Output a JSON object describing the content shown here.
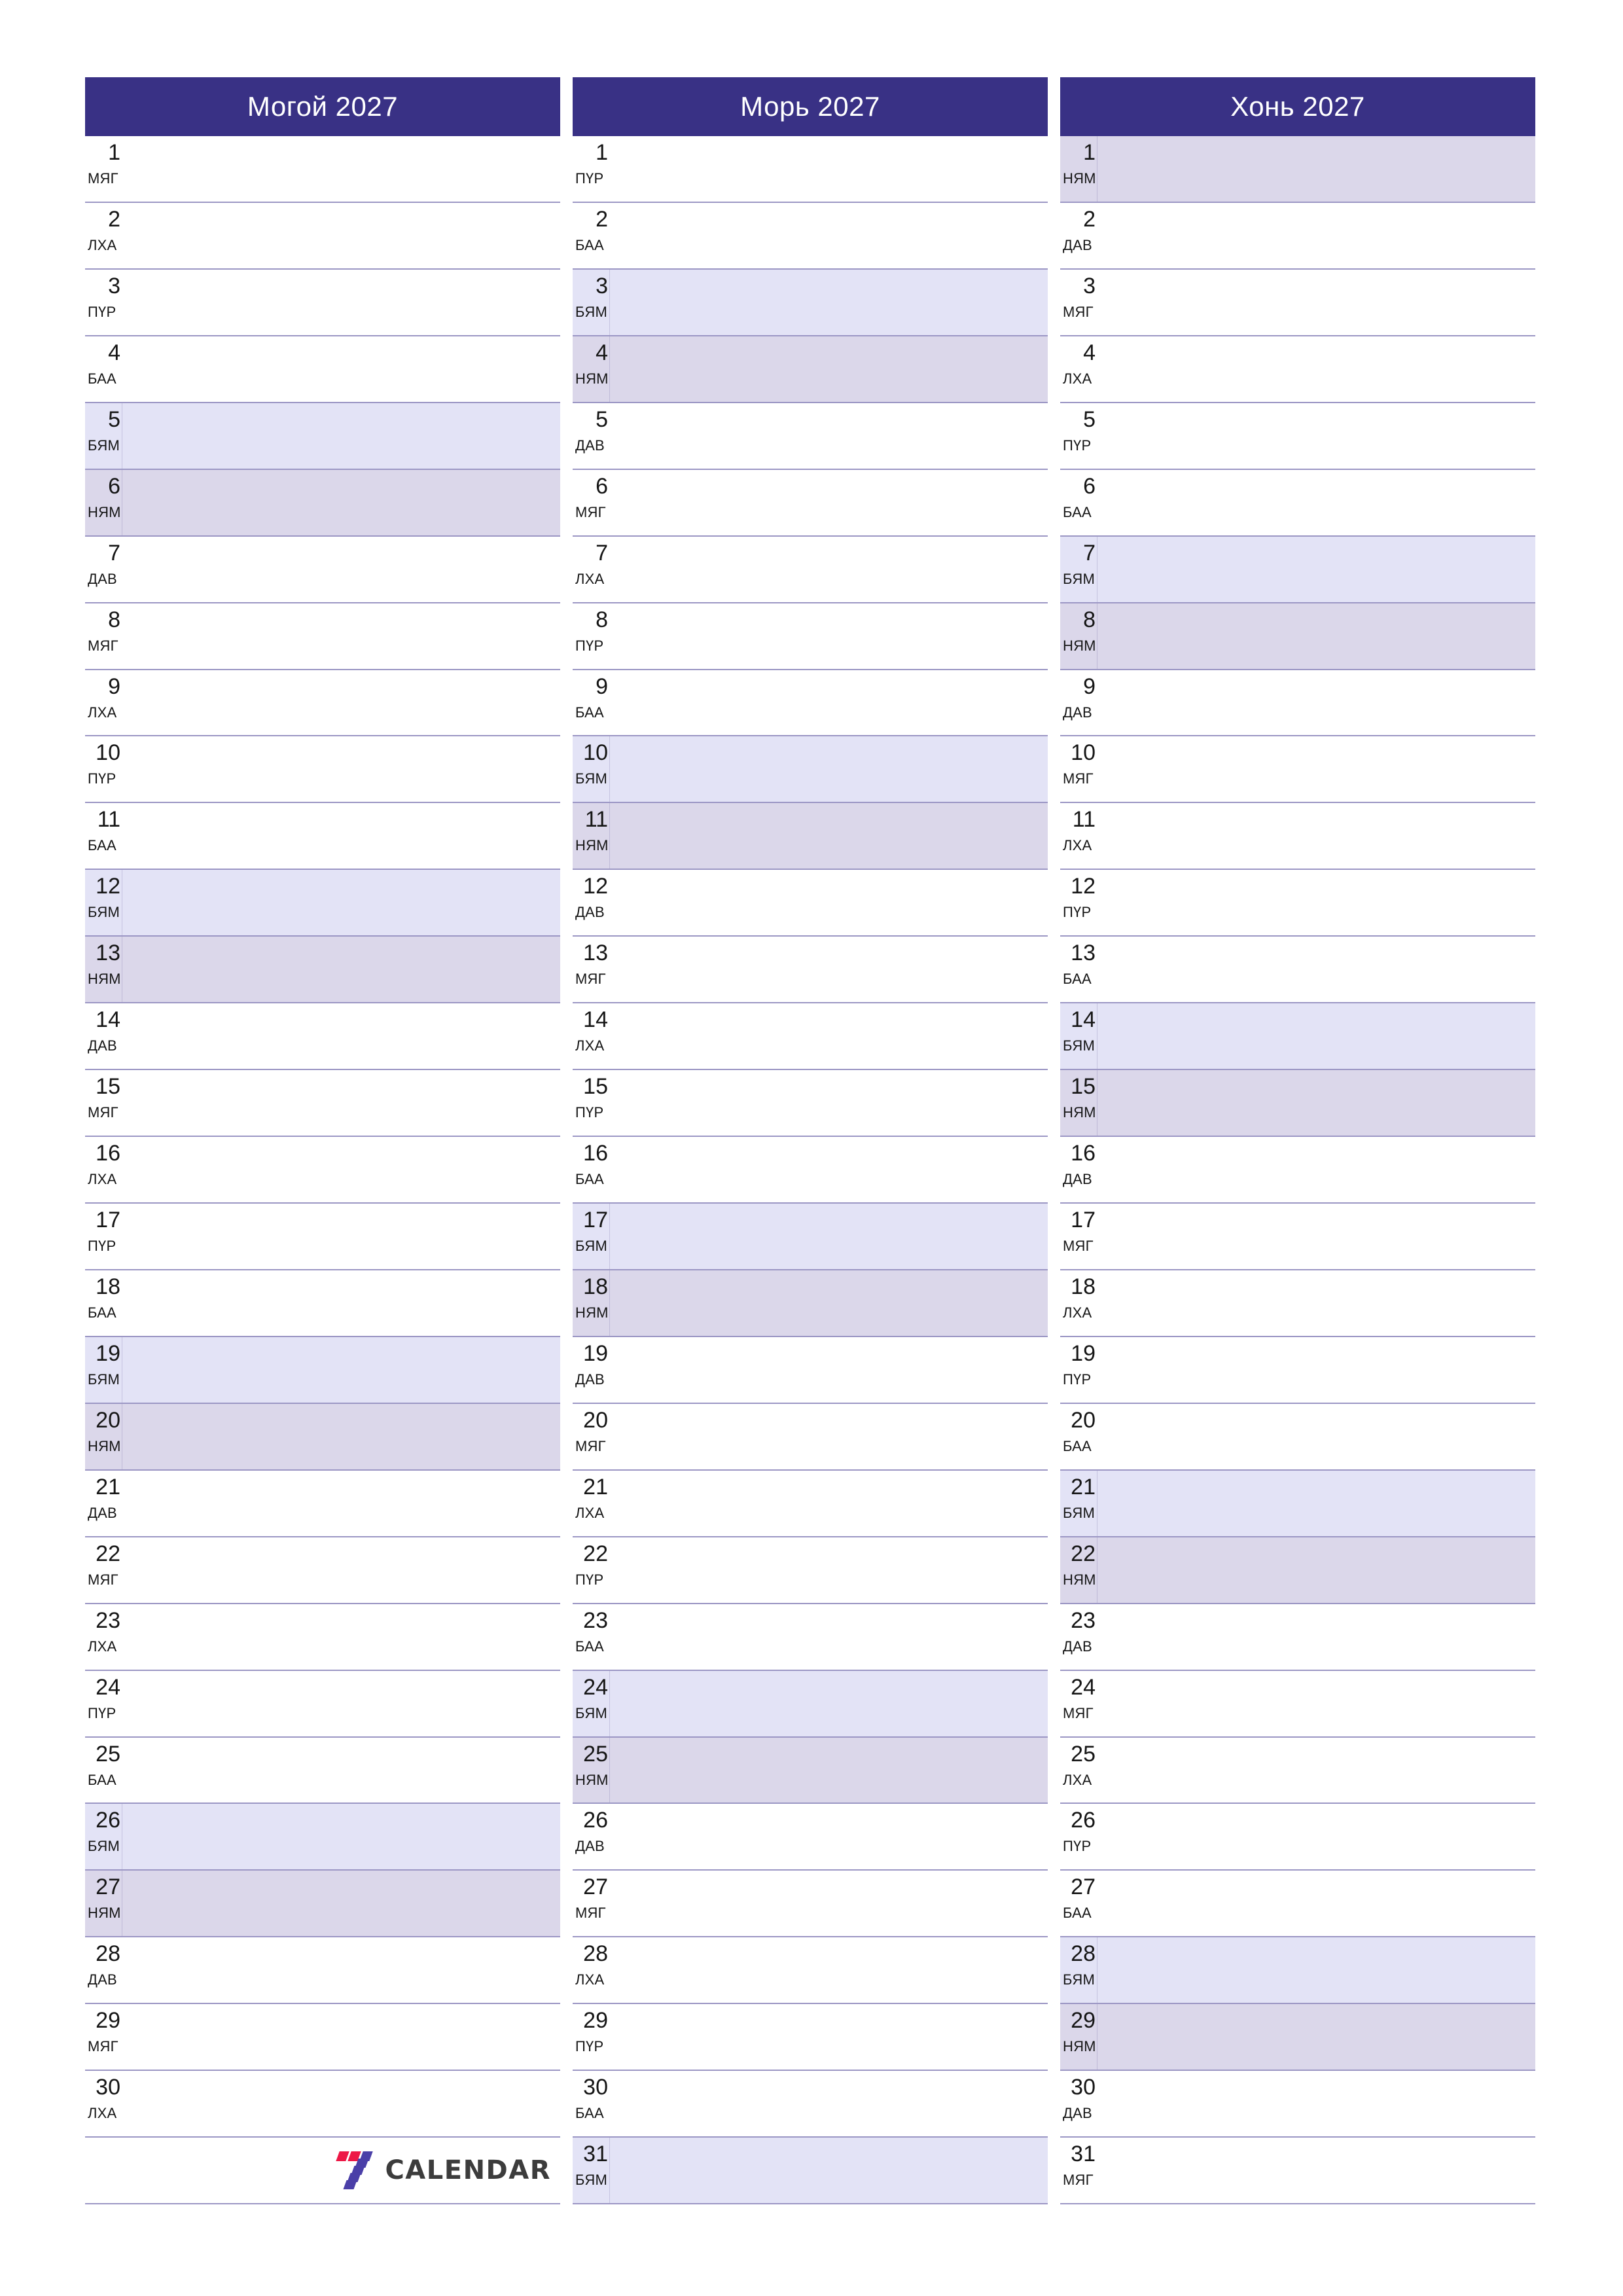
{
  "page": {
    "type": "monthly-planner",
    "year": "2027",
    "columns": 3,
    "orientation": "portrait"
  },
  "theme": {
    "header_bg": "#393185",
    "header_text": "#ffffff",
    "grid_line": "#9b96c4",
    "saturday_bg": "#e3e3f6",
    "sunday_bg": "#dbd7ea",
    "page_bg": "#ffffff",
    "day_text": "#161616"
  },
  "weekday_labels": {
    "mon": "ДАВ",
    "tue": "МЯГ",
    "wed": "ЛХА",
    "thu": "ПҮР",
    "fri": "БАА",
    "sat": "БЯМ",
    "sun": "НЯМ"
  },
  "footer": {
    "logo_text": "CALENDAR",
    "logo_mark": "seven-mark",
    "colors": {
      "red": "#ed1846",
      "purple": "#4a3fa8",
      "text": "#3c3c3c"
    }
  },
  "months": [
    {
      "title": "Могой 2027",
      "days": [
        {
          "num": "1",
          "name": "МЯГ",
          "kind": "plain"
        },
        {
          "num": "2",
          "name": "ЛХА",
          "kind": "plain"
        },
        {
          "num": "3",
          "name": "ПҮР",
          "kind": "plain"
        },
        {
          "num": "4",
          "name": "БАА",
          "kind": "plain"
        },
        {
          "num": "5",
          "name": "БЯМ",
          "kind": "sat"
        },
        {
          "num": "6",
          "name": "НЯМ",
          "kind": "sun"
        },
        {
          "num": "7",
          "name": "ДАВ",
          "kind": "plain"
        },
        {
          "num": "8",
          "name": "МЯГ",
          "kind": "plain"
        },
        {
          "num": "9",
          "name": "ЛХА",
          "kind": "plain"
        },
        {
          "num": "10",
          "name": "ПҮР",
          "kind": "plain"
        },
        {
          "num": "11",
          "name": "БАА",
          "kind": "plain"
        },
        {
          "num": "12",
          "name": "БЯМ",
          "kind": "sat"
        },
        {
          "num": "13",
          "name": "НЯМ",
          "kind": "sun"
        },
        {
          "num": "14",
          "name": "ДАВ",
          "kind": "plain"
        },
        {
          "num": "15",
          "name": "МЯГ",
          "kind": "plain"
        },
        {
          "num": "16",
          "name": "ЛХА",
          "kind": "plain"
        },
        {
          "num": "17",
          "name": "ПҮР",
          "kind": "plain"
        },
        {
          "num": "18",
          "name": "БАА",
          "kind": "plain"
        },
        {
          "num": "19",
          "name": "БЯМ",
          "kind": "sat"
        },
        {
          "num": "20",
          "name": "НЯМ",
          "kind": "sun"
        },
        {
          "num": "21",
          "name": "ДАВ",
          "kind": "plain"
        },
        {
          "num": "22",
          "name": "МЯГ",
          "kind": "plain"
        },
        {
          "num": "23",
          "name": "ЛХА",
          "kind": "plain"
        },
        {
          "num": "24",
          "name": "ПҮР",
          "kind": "plain"
        },
        {
          "num": "25",
          "name": "БАА",
          "kind": "plain"
        },
        {
          "num": "26",
          "name": "БЯМ",
          "kind": "sat"
        },
        {
          "num": "27",
          "name": "НЯМ",
          "kind": "sun"
        },
        {
          "num": "28",
          "name": "ДАВ",
          "kind": "plain"
        },
        {
          "num": "29",
          "name": "МЯГ",
          "kind": "plain"
        },
        {
          "num": "30",
          "name": "ЛХА",
          "kind": "plain"
        },
        {
          "num": "",
          "name": "",
          "kind": "empty"
        }
      ]
    },
    {
      "title": "Морь 2027",
      "days": [
        {
          "num": "1",
          "name": "ПҮР",
          "kind": "plain"
        },
        {
          "num": "2",
          "name": "БАА",
          "kind": "plain"
        },
        {
          "num": "3",
          "name": "БЯМ",
          "kind": "sat"
        },
        {
          "num": "4",
          "name": "НЯМ",
          "kind": "sun"
        },
        {
          "num": "5",
          "name": "ДАВ",
          "kind": "plain"
        },
        {
          "num": "6",
          "name": "МЯГ",
          "kind": "plain"
        },
        {
          "num": "7",
          "name": "ЛХА",
          "kind": "plain"
        },
        {
          "num": "8",
          "name": "ПҮР",
          "kind": "plain"
        },
        {
          "num": "9",
          "name": "БАА",
          "kind": "plain"
        },
        {
          "num": "10",
          "name": "БЯМ",
          "kind": "sat"
        },
        {
          "num": "11",
          "name": "НЯМ",
          "kind": "sun"
        },
        {
          "num": "12",
          "name": "ДАВ",
          "kind": "plain"
        },
        {
          "num": "13",
          "name": "МЯГ",
          "kind": "plain"
        },
        {
          "num": "14",
          "name": "ЛХА",
          "kind": "plain"
        },
        {
          "num": "15",
          "name": "ПҮР",
          "kind": "plain"
        },
        {
          "num": "16",
          "name": "БАА",
          "kind": "plain"
        },
        {
          "num": "17",
          "name": "БЯМ",
          "kind": "sat"
        },
        {
          "num": "18",
          "name": "НЯМ",
          "kind": "sun"
        },
        {
          "num": "19",
          "name": "ДАВ",
          "kind": "plain"
        },
        {
          "num": "20",
          "name": "МЯГ",
          "kind": "plain"
        },
        {
          "num": "21",
          "name": "ЛХА",
          "kind": "plain"
        },
        {
          "num": "22",
          "name": "ПҮР",
          "kind": "plain"
        },
        {
          "num": "23",
          "name": "БАА",
          "kind": "plain"
        },
        {
          "num": "24",
          "name": "БЯМ",
          "kind": "sat"
        },
        {
          "num": "25",
          "name": "НЯМ",
          "kind": "sun"
        },
        {
          "num": "26",
          "name": "ДАВ",
          "kind": "plain"
        },
        {
          "num": "27",
          "name": "МЯГ",
          "kind": "plain"
        },
        {
          "num": "28",
          "name": "ЛХА",
          "kind": "plain"
        },
        {
          "num": "29",
          "name": "ПҮР",
          "kind": "plain"
        },
        {
          "num": "30",
          "name": "БАА",
          "kind": "plain"
        },
        {
          "num": "31",
          "name": "БЯМ",
          "kind": "sat"
        }
      ]
    },
    {
      "title": "Хонь 2027",
      "days": [
        {
          "num": "1",
          "name": "НЯМ",
          "kind": "sun"
        },
        {
          "num": "2",
          "name": "ДАВ",
          "kind": "plain"
        },
        {
          "num": "3",
          "name": "МЯГ",
          "kind": "plain"
        },
        {
          "num": "4",
          "name": "ЛХА",
          "kind": "plain"
        },
        {
          "num": "5",
          "name": "ПҮР",
          "kind": "plain"
        },
        {
          "num": "6",
          "name": "БАА",
          "kind": "plain"
        },
        {
          "num": "7",
          "name": "БЯМ",
          "kind": "sat"
        },
        {
          "num": "8",
          "name": "НЯМ",
          "kind": "sun"
        },
        {
          "num": "9",
          "name": "ДАВ",
          "kind": "plain"
        },
        {
          "num": "10",
          "name": "МЯГ",
          "kind": "plain"
        },
        {
          "num": "11",
          "name": "ЛХА",
          "kind": "plain"
        },
        {
          "num": "12",
          "name": "ПҮР",
          "kind": "plain"
        },
        {
          "num": "13",
          "name": "БАА",
          "kind": "plain"
        },
        {
          "num": "14",
          "name": "БЯМ",
          "kind": "sat"
        },
        {
          "num": "15",
          "name": "НЯМ",
          "kind": "sun"
        },
        {
          "num": "16",
          "name": "ДАВ",
          "kind": "plain"
        },
        {
          "num": "17",
          "name": "МЯГ",
          "kind": "plain"
        },
        {
          "num": "18",
          "name": "ЛХА",
          "kind": "plain"
        },
        {
          "num": "19",
          "name": "ПҮР",
          "kind": "plain"
        },
        {
          "num": "20",
          "name": "БАА",
          "kind": "plain"
        },
        {
          "num": "21",
          "name": "БЯМ",
          "kind": "sat"
        },
        {
          "num": "22",
          "name": "НЯМ",
          "kind": "sun"
        },
        {
          "num": "23",
          "name": "ДАВ",
          "kind": "plain"
        },
        {
          "num": "24",
          "name": "МЯГ",
          "kind": "plain"
        },
        {
          "num": "25",
          "name": "ЛХА",
          "kind": "plain"
        },
        {
          "num": "26",
          "name": "ПҮР",
          "kind": "plain"
        },
        {
          "num": "27",
          "name": "БАА",
          "kind": "plain"
        },
        {
          "num": "28",
          "name": "БЯМ",
          "kind": "sat"
        },
        {
          "num": "29",
          "name": "НЯМ",
          "kind": "sun"
        },
        {
          "num": "30",
          "name": "ДАВ",
          "kind": "plain"
        },
        {
          "num": "31",
          "name": "МЯГ",
          "kind": "plain"
        }
      ]
    }
  ]
}
